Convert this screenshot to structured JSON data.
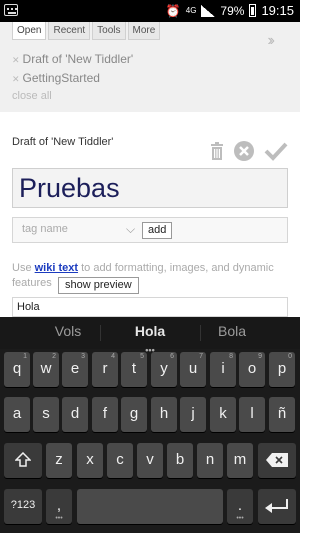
{
  "status_bar": {
    "network": "4G",
    "battery": "79%",
    "time": "19:15",
    "icons": [
      "keyboard-icon",
      "alarm-icon",
      "signal-icon",
      "battery-icon"
    ]
  },
  "sidebar": {
    "tabs": [
      "Open",
      "Recent",
      "Tools",
      "More"
    ],
    "open_items": [
      "Draft of 'New Tiddler'",
      "GettingStarted"
    ],
    "close_all": "close all"
  },
  "editor": {
    "draft_title": "Draft of 'New Tiddler'",
    "title_value": "Pruebas",
    "tag_placeholder": "tag name",
    "add_label": "add",
    "hint_prefix": "Use",
    "hint_link": "wiki text",
    "hint_suffix": "to add formatting, images, and dynamic features",
    "preview_label": "show preview",
    "body_value": "Hola"
  },
  "keyboard": {
    "suggestions": [
      "Vols",
      "Hola",
      "Bola"
    ],
    "row1": [
      "q",
      "w",
      "e",
      "r",
      "t",
      "y",
      "u",
      "i",
      "o",
      "p"
    ],
    "row1_hints": [
      "1",
      "2",
      "3",
      "4",
      "5",
      "6",
      "7",
      "8",
      "9",
      "0"
    ],
    "row2": [
      "a",
      "s",
      "d",
      "f",
      "g",
      "h",
      "j",
      "k",
      "l",
      "ñ"
    ],
    "row3": [
      "z",
      "x",
      "c",
      "v",
      "b",
      "n",
      "m"
    ],
    "symbols_label": "?123",
    "comma": ",",
    "period": "."
  }
}
